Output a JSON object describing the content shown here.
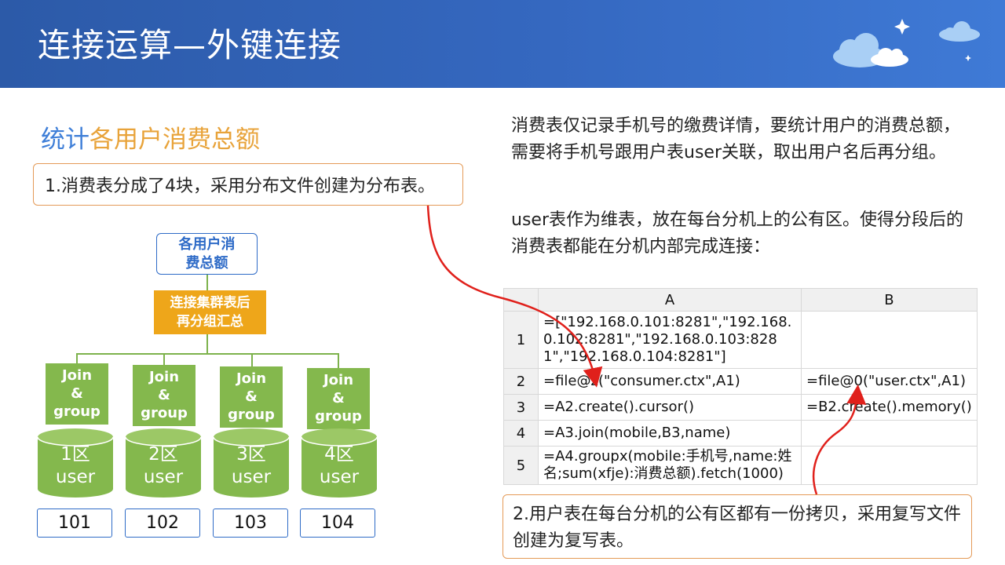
{
  "header": {
    "title": "连接运算—外键连接"
  },
  "subtitle": {
    "part1": "统计",
    "part2": "各用户消费总额"
  },
  "callouts": {
    "c1": "1.消费表分成了4块，采用分布文件创建为分布表。",
    "c2": "2.用户表在每台分机的公有区都有一份拷贝，采用复写文件创建为复写表。"
  },
  "description": {
    "p1": "消费表仅记录手机号的缴费详情，要统计用户的消费总额，需要将手机号跟用户表user关联，取出用户名后再分组。",
    "p2": "user表作为维表，放在每台分机上的公有区。使得分段后的消费表都能在分机内部完成连接："
  },
  "diagram": {
    "top_line1": "各用户消",
    "top_line2": "费总额",
    "mid_line1": "连接集群表后",
    "mid_line2": "再分组汇总",
    "nodes": [
      {
        "jg1": "Join",
        "jg2": "&",
        "jg3": "group",
        "zone": "1区",
        "table": "user",
        "num": "101"
      },
      {
        "jg1": "Join",
        "jg2": "&",
        "jg3": "group",
        "zone": "2区",
        "table": "user",
        "num": "102"
      },
      {
        "jg1": "Join",
        "jg2": "&",
        "jg3": "group",
        "zone": "3区",
        "table": "user",
        "num": "103"
      },
      {
        "jg1": "Join",
        "jg2": "&",
        "jg3": "group",
        "zone": "4区",
        "table": "user",
        "num": "104"
      }
    ],
    "colors": {
      "green": "#84b84d",
      "orange": "#eea61a",
      "blue": "#2e6bc7",
      "arrow": "#e0201b"
    }
  },
  "sheet": {
    "col_a": "A",
    "col_b": "B",
    "rows": [
      {
        "n": "1",
        "a": "=[\"192.168.0.101:8281\",\"192.168.0.102:8281\",\"192.168.0.103:8281\",\"192.168.0.104:8281\"]",
        "b": ""
      },
      {
        "n": "2",
        "a": "=file@z(\"consumer.ctx\",A1)",
        "b": "=file@0(\"user.ctx\",A1)"
      },
      {
        "n": "3",
        "a": "=A2.create().cursor()",
        "b": "=B2.create().memory()"
      },
      {
        "n": "4",
        "a": "=A3.join(mobile,B3,name)",
        "b": ""
      },
      {
        "n": "5",
        "a": "=A4.groupx(mobile:手机号,name:姓名;sum(xfje):消费总额).fetch(1000)",
        "b": ""
      }
    ]
  }
}
